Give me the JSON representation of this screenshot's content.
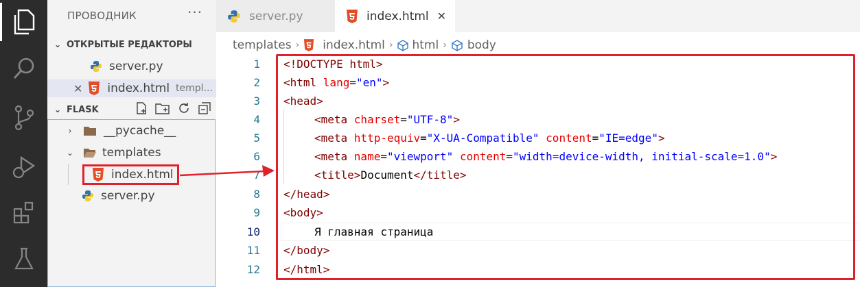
{
  "explorer": {
    "title": "ПРОВОДНИК",
    "more": "···",
    "open_editors_header": "ОТКРЫТЫЕ РЕДАКТОРЫ",
    "open_editors": [
      {
        "name": "server.py",
        "hint": ""
      },
      {
        "name": "index.html",
        "hint": "templ..."
      }
    ],
    "folder_header": "FLASK",
    "tree": {
      "pycache": "__pycache__",
      "templates": "templates",
      "index": "index.html",
      "server": "server.py"
    }
  },
  "tabs": [
    {
      "label": "server.py",
      "icon": "python-icon"
    },
    {
      "label": "index.html",
      "icon": "html5-icon",
      "close": "✕"
    }
  ],
  "breadcrumb": [
    "templates",
    "index.html",
    "html",
    "body"
  ],
  "line_numbers": [
    "1",
    "2",
    "3",
    "4",
    "5",
    "6",
    "7",
    "8",
    "9",
    "10",
    "11",
    "12"
  ],
  "code": {
    "doctype": "<!DOCTYPE html>",
    "l2_open": "<html ",
    "l2_attr": "lang",
    "l2_eq": "=",
    "l2_val": "\"en\"",
    "l2_close": ">",
    "l3": "<head>",
    "meta": "<meta ",
    "charset_attr": "charset",
    "charset_val": "\"UTF-8\"",
    "httpequiv_attr": "http-equiv",
    "httpequiv_val": "\"X-UA-Compatible\"",
    "content_attr": "content",
    "content_val1": "\"IE=edge\"",
    "name_attr": "name",
    "name_val": "\"viewport\"",
    "content_val2": "\"width=device-width, initial-scale=1.0\"",
    "title_open": "<title>",
    "title_text": "Document",
    "title_close": "</title>",
    "head_close": "</head>",
    "body_open": "<body>",
    "body_text": "Я главная страница",
    "body_close": "</body>",
    "html_close": "</html>",
    "gt": ">",
    "eq": "=",
    "sp": " "
  },
  "colors": {
    "annotation": "#e0212b",
    "activity_bar": "#2c2c2c"
  }
}
